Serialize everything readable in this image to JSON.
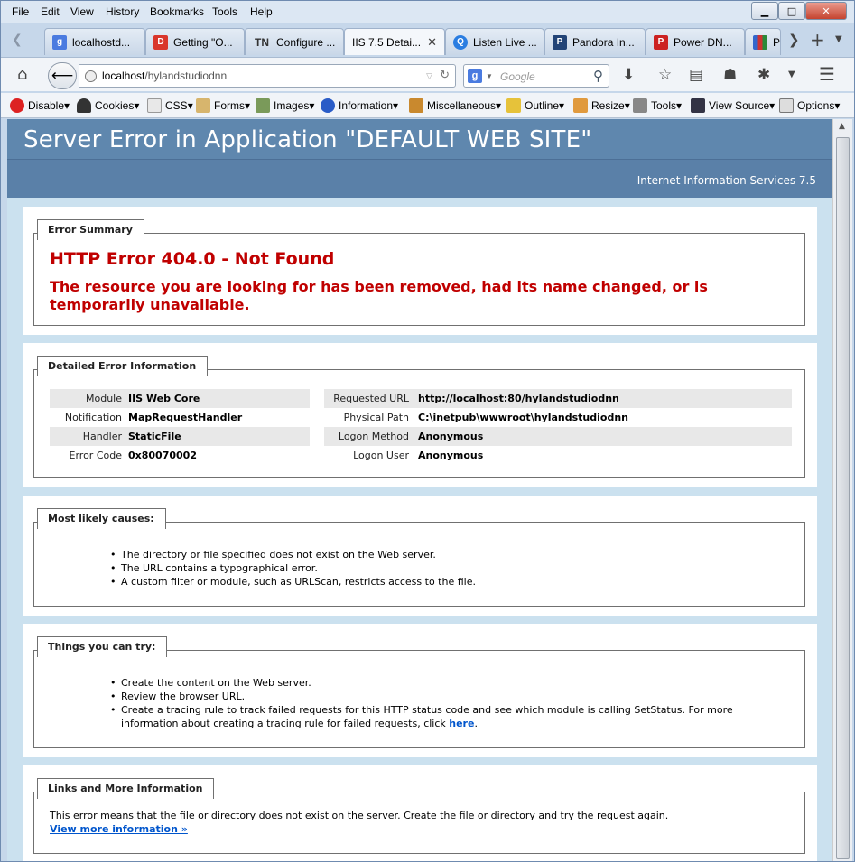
{
  "menu": [
    "File",
    "Edit",
    "View",
    "History",
    "Bookmarks",
    "Tools",
    "Help"
  ],
  "window_controls": {
    "minimize": "▁",
    "maximize": "□",
    "close": "✕"
  },
  "tabs": [
    {
      "label": "localhostd...",
      "icon": "google",
      "color": "#4a7be0",
      "glyph": "g"
    },
    {
      "label": "Getting \"O...",
      "icon": "dnn",
      "color": "#d9362b",
      "glyph": "D"
    },
    {
      "label": "Configure ...",
      "icon": "tn",
      "color": "#ffffff",
      "glyph": "TN"
    },
    {
      "label": "IIS 7.5 Detai...",
      "icon": "none",
      "color": "",
      "glyph": ""
    },
    {
      "label": "Listen Live ...",
      "icon": "q",
      "color": "#2a7de1",
      "glyph": "Q"
    },
    {
      "label": "Pandora In...",
      "icon": "pandora",
      "color": "#224477",
      "glyph": "P"
    },
    {
      "label": "Power DN...",
      "icon": "power",
      "color": "#cc2222",
      "glyph": "P"
    },
    {
      "label": "Pa",
      "icon": "chart",
      "color": "#cc3333",
      "glyph": ""
    }
  ],
  "nav": {
    "url_host": "localhost",
    "url_path": "/hylandstudiodnn",
    "search_placeholder": "Google"
  },
  "devtools": [
    "Disable",
    "Cookies",
    "CSS",
    "Forms",
    "Images",
    "Information",
    "Miscellaneous",
    "Outline",
    "Resize",
    "Tools",
    "View Source",
    "Options"
  ],
  "page": {
    "title": "Server Error in Application \"DEFAULT WEB SITE\"",
    "server": "Internet Information Services 7.5",
    "summary_legend": "Error Summary",
    "error_title": "HTTP Error 404.0 - Not Found",
    "error_desc": "The resource you are looking for has been removed, had its name changed, or is temporarily unavailable.",
    "detail_legend": "Detailed Error Information",
    "details_left": [
      {
        "k": "Module",
        "v": "IIS Web Core"
      },
      {
        "k": "Notification",
        "v": "MapRequestHandler"
      },
      {
        "k": "Handler",
        "v": "StaticFile"
      },
      {
        "k": "Error Code",
        "v": "0x80070002"
      }
    ],
    "details_right": [
      {
        "k": "Requested URL",
        "v": "http://localhost:80/hylandstudiodnn"
      },
      {
        "k": "Physical Path",
        "v": "C:\\inetpub\\wwwroot\\hylandstudiodnn"
      },
      {
        "k": "Logon Method",
        "v": "Anonymous"
      },
      {
        "k": "Logon User",
        "v": "Anonymous"
      }
    ],
    "causes_legend": "Most likely causes:",
    "causes": [
      "The directory or file specified does not exist on the Web server.",
      "The URL contains a typographical error.",
      "A custom filter or module, such as URLScan, restricts access to the file."
    ],
    "try_legend": "Things you can try:",
    "try": [
      "Create the content on the Web server.",
      "Review the browser URL."
    ],
    "try_last_text": "Create a tracing rule to track failed requests for this HTTP status code and see which module is calling SetStatus. For more information about creating a tracing rule for failed requests, click ",
    "try_last_link": "here",
    "links_legend": "Links and More Information",
    "links_text": "This error means that the file or directory does not exist on the server. Create the file or directory and try the request again.",
    "links_more": "View more information »"
  }
}
